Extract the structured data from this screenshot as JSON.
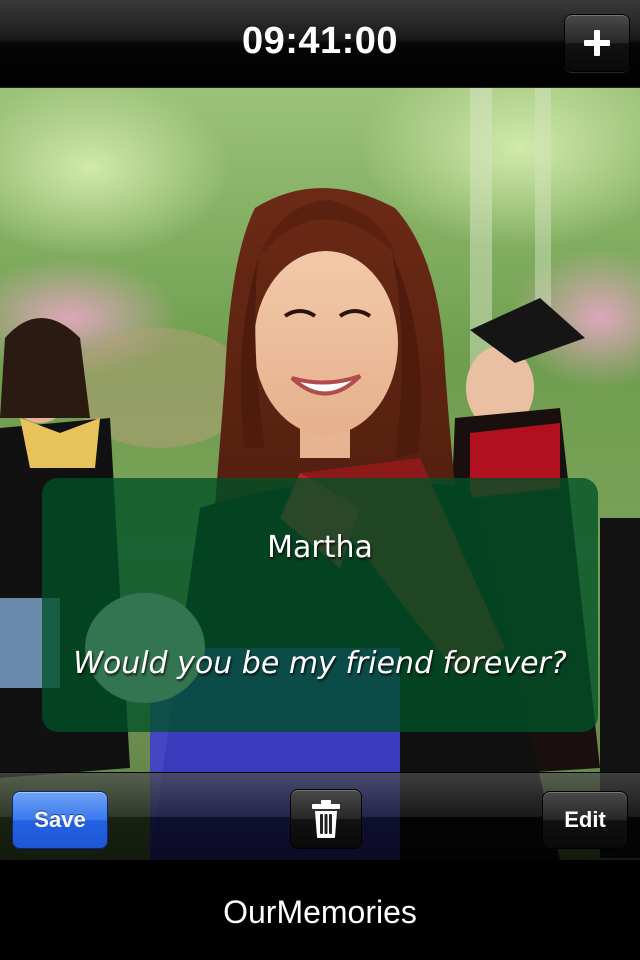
{
  "header": {
    "clock": "09:41:00",
    "add_icon": "plus-icon"
  },
  "photo": {
    "description_icon": "photo"
  },
  "card": {
    "name": "Martha",
    "message": "Would you be my friend forever?",
    "background_color": "#005226"
  },
  "toolbar": {
    "save_label": "Save",
    "trash_icon": "trash-icon",
    "edit_label": "Edit",
    "save_color": "#2f6de8"
  },
  "footer": {
    "app_name": "OurMemories"
  }
}
